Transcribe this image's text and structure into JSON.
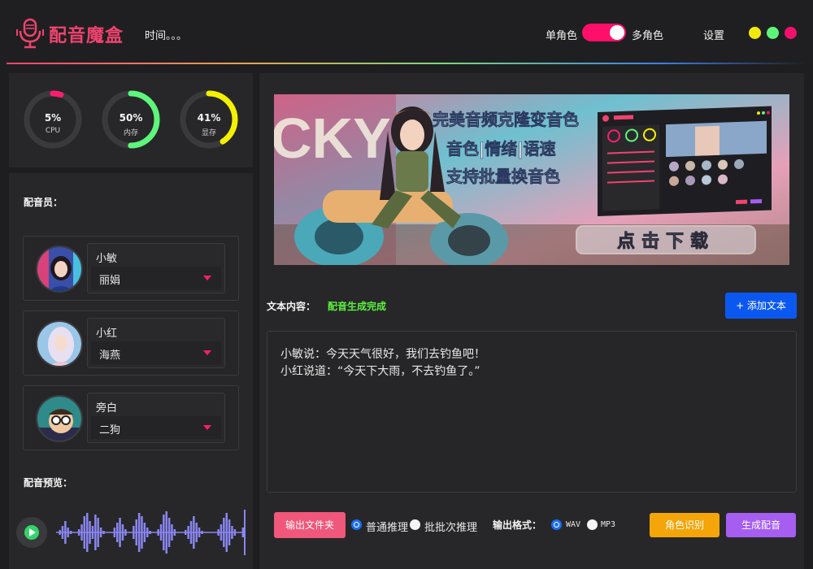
{
  "header": {
    "app_title": "配音魔盒",
    "time_label": "时间。。。",
    "mode_single": "单角色",
    "mode_multi": "多角色",
    "settings": "设置",
    "accent_color": "#f0436f"
  },
  "stats": [
    {
      "percent": "5%",
      "label": "CPU",
      "value": 5,
      "color": "#ff1d70"
    },
    {
      "percent": "50%",
      "label": "内存",
      "value": 50,
      "color": "#5ef57b"
    },
    {
      "percent": "41%",
      "label": "显存",
      "value": 41,
      "color": "#f5f000"
    }
  ],
  "voice_panel": {
    "title": "配音员：",
    "actors": [
      {
        "name": "小敏",
        "voice": "丽娟"
      },
      {
        "name": "小红",
        "voice": "海燕"
      },
      {
        "name": "旁白",
        "voice": "二狗"
      }
    ],
    "preview_title": "配音预览："
  },
  "banner": {
    "line1": "完美音频克隆变音色",
    "line2": "音色|情绪|语速",
    "line3": "支持批量换音色",
    "download": "点击下载"
  },
  "main": {
    "text_label": "文本内容：",
    "status": "配音生成完成",
    "add_text": "+ 添加文本",
    "text_line1": "小敏说：今天天气很好，我们去钓鱼吧！",
    "text_line2": "小红说道：“今天下大雨，不去钓鱼了。”",
    "output_folder": "输出文件夹",
    "infer_normal": "普通推理",
    "infer_batch": "批批次推理",
    "format_label": "输出格式：",
    "format_wav": "WAV",
    "format_mp3": "MP3",
    "role_detect": "角色识别",
    "generate": "生成配音"
  }
}
